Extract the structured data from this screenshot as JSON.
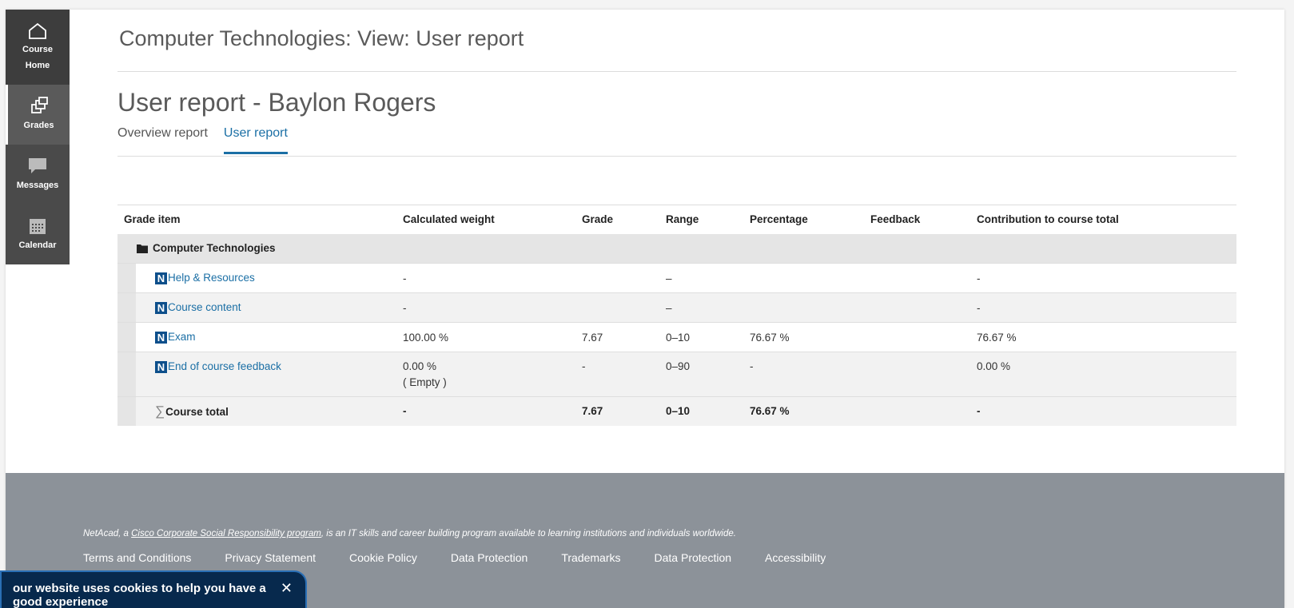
{
  "nav": [
    {
      "label": "Course Home",
      "icon": "home-icon"
    },
    {
      "label": "Grades",
      "icon": "grades-icon"
    },
    {
      "label": "Messages",
      "icon": "chat-icon"
    },
    {
      "label": "Calendar",
      "icon": "calendar-icon"
    }
  ],
  "header": {
    "course_title": "Computer Technologies: View: User report",
    "report_title": "User report - Baylon Rogers"
  },
  "tabs": [
    "Overview report",
    "User report"
  ],
  "table": {
    "headers": [
      "Grade item",
      "Calculated weight",
      "Grade",
      "Range",
      "Percentage",
      "Feedback",
      "Contribution to course total"
    ],
    "category": "Computer Technologies",
    "rows": [
      {
        "name": "Help & Resources",
        "weight": "-",
        "weight2": "",
        "grade": "",
        "range": "–",
        "percentage": "",
        "feedback": "",
        "contribution": "-"
      },
      {
        "name": "Course content",
        "weight": "-",
        "weight2": "",
        "grade": "",
        "range": "–",
        "percentage": "",
        "feedback": "",
        "contribution": "-"
      },
      {
        "name": "Exam",
        "weight": "100.00 %",
        "weight2": "",
        "grade": "7.67",
        "range": "0–10",
        "percentage": "76.67 %",
        "feedback": "",
        "contribution": "76.67 %"
      },
      {
        "name": "End of course feedback",
        "weight": "0.00 %",
        "weight2": "( Empty )",
        "grade": "-",
        "range": "0–90",
        "percentage": "-",
        "feedback": "",
        "contribution": "0.00 %"
      }
    ],
    "badge": "N",
    "total": {
      "name": "Course total",
      "sigma": "∑",
      "weight": "-",
      "grade": "7.67",
      "range": "0–10",
      "percentage": "76.67 %",
      "feedback": "",
      "contribution": "-"
    }
  },
  "footer": {
    "note_prefix": "NetAcad, a ",
    "note_link": "Cisco Corporate Social Responsibility program",
    "note_suffix": ", is an IT skills and career building program available to learning institutions and individuals worldwide.",
    "links": [
      "Terms and Conditions",
      "Privacy Statement",
      "Cookie Policy",
      "Data Protection",
      "Trademarks",
      "Data Protection",
      "Accessibility"
    ]
  },
  "banner": {
    "text": "our website uses cookies to help you have a good experience",
    "close": "✕"
  },
  "colors": {
    "link": "#1b6fa5",
    "nav_bg": "#4a4a4a",
    "footer_bg": "#8c9299",
    "badge": "#0d4f8b"
  }
}
